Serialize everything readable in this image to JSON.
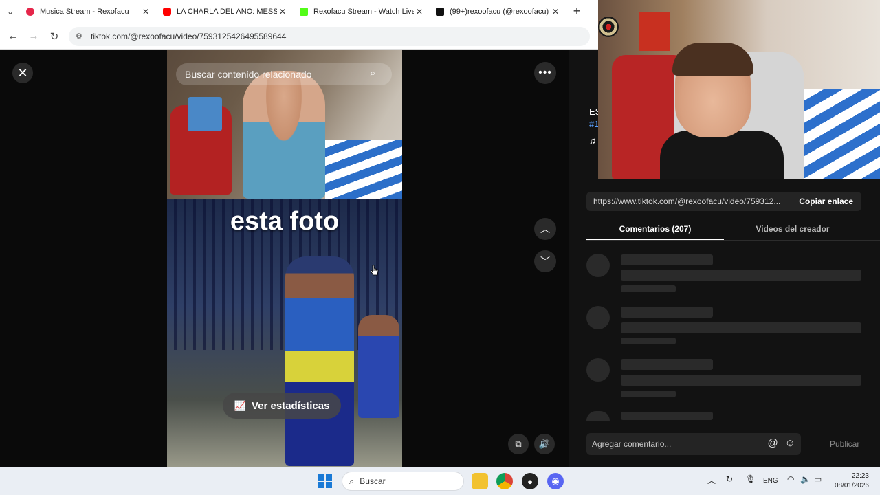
{
  "browser": {
    "tabs": [
      {
        "title": "Musica Stream - Rexofacu",
        "favicon_color": "#e5264a"
      },
      {
        "title": "LA CHARLA DEL AÑO: MESSI D",
        "favicon_color": "#ff0000"
      },
      {
        "title": "Rexofacu Stream - Watch Live o",
        "favicon_color": "#53fc18"
      },
      {
        "title": "(99+)rexoofacu (@rexoofacu) |",
        "favicon_color": "#111111"
      }
    ],
    "close_glyph": "✕",
    "new_tab_glyph": "+",
    "url": "tiktok.com/@rexoofacu/video/7593125426495589644"
  },
  "video": {
    "search_placeholder": "Buscar contenido relacionado",
    "overlay_text": "esta foto",
    "stats_label": "Ver estadísticas"
  },
  "panel": {
    "partial_lines": [
      "ES",
      "#1",
      "♫"
    ],
    "share_url": "https://www.tiktok.com/@rexoofacu/video/759312...",
    "copy_label": "Copiar enlace",
    "tabs": [
      {
        "label": "Comentarios (207)",
        "active": true
      },
      {
        "label": "Videos del creador",
        "active": false
      }
    ],
    "comment_placeholder": "Agregar comentario...",
    "publish_label": "Publicar"
  },
  "taskbar": {
    "search_label": "Buscar",
    "language": "ENG",
    "time": "22:23",
    "date": "08/01/2026"
  },
  "colors": {
    "accent_tiktok": "#fe2c55",
    "panel_bg": "#121212"
  }
}
